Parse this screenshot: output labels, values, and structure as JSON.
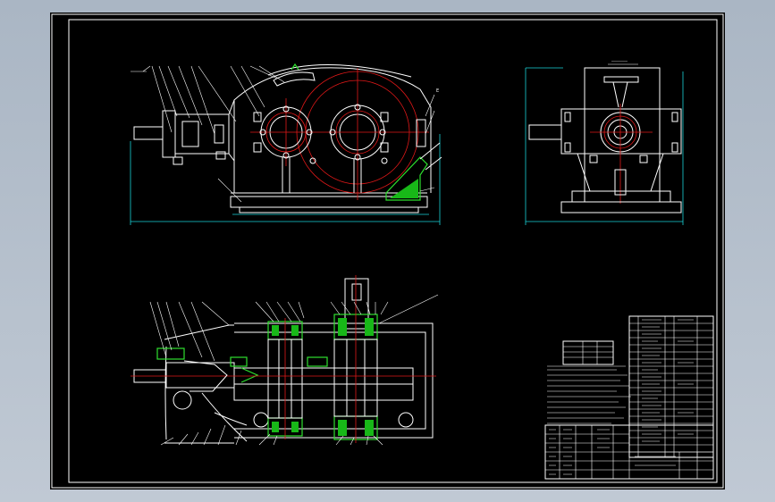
{
  "drawing": {
    "side_view_mark": "E",
    "colors": {
      "background": "#000000",
      "geometry": "#ffffff",
      "dimensions": "#19d2d8",
      "centerlines": "#e01818",
      "sections": "#2ee02e",
      "viewport": "#b1bcc9"
    }
  }
}
